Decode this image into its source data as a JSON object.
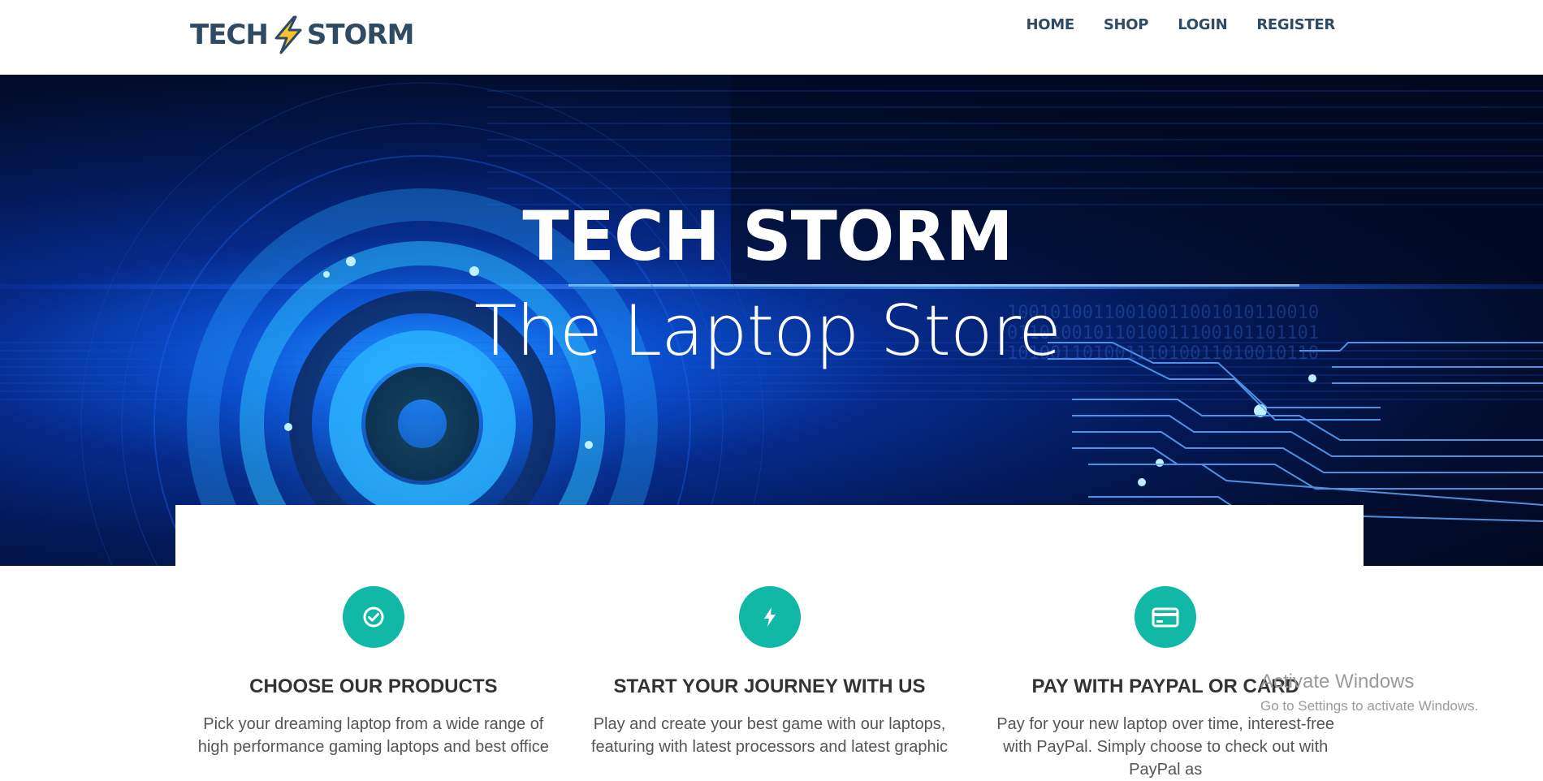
{
  "brand": {
    "logo_left": "TECH",
    "logo_right": "STORM"
  },
  "nav": {
    "home": "HOME",
    "shop": "SHOP",
    "login": "LOGIN",
    "register": "REGISTER"
  },
  "hero": {
    "title": "TECH STORM",
    "subtitle": "The Laptop Store"
  },
  "features": [
    {
      "icon": "check-circle-icon",
      "title": "CHOOSE OUR PRODUCTS",
      "text": "Pick your dreaming laptop from a wide range of high performance gaming laptops and best office"
    },
    {
      "icon": "bolt-icon",
      "title": "START YOUR JOURNEY WITH US",
      "text": "Play and create your best game with our laptops, featuring with latest processors and latest graphic"
    },
    {
      "icon": "credit-card-icon",
      "title": "PAY WITH PAYPAL OR CARD",
      "text": "Pay for your new laptop over time, interest-free with PayPal. Simply choose to check out with PayPal as"
    }
  ],
  "watermark": {
    "line1": "Activate Windows",
    "line2": "Go to Settings to activate Windows."
  },
  "colors": {
    "nav_text": "#2f4a63",
    "accent_teal": "#12b8a6",
    "bolt_yellow": "#f5c431"
  }
}
